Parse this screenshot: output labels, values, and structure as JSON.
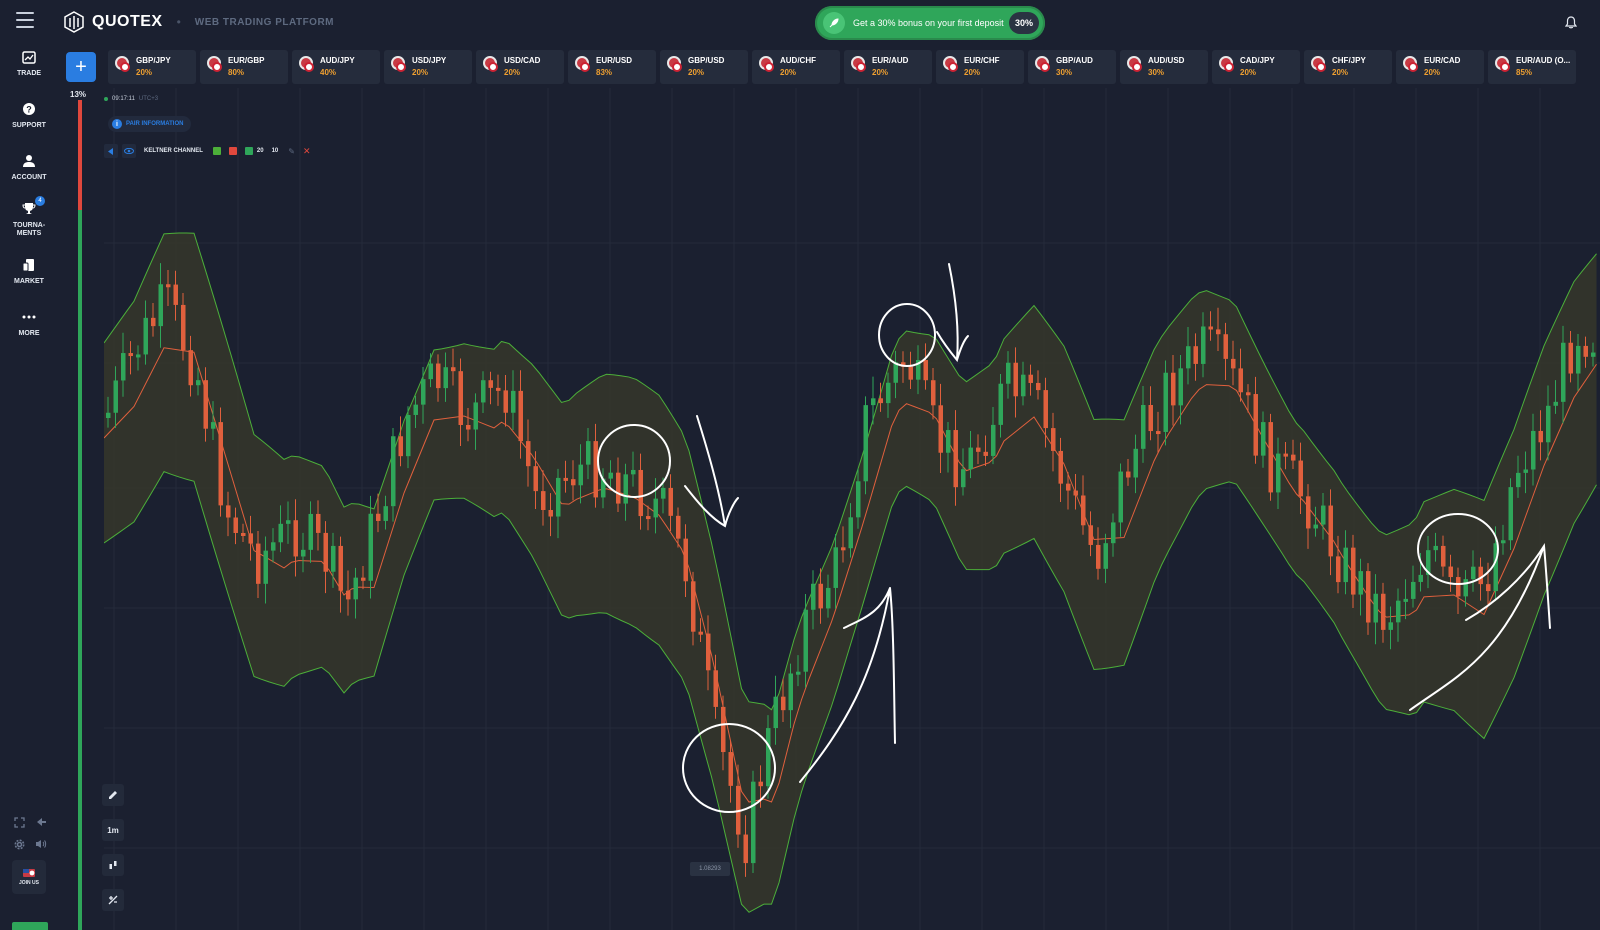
{
  "header": {
    "brand": "QUOTEX",
    "subtitle": "WEB TRADING PLATFORM",
    "bonus_text": "Get a 30% bonus on your first deposit",
    "bonus_pct": "30%"
  },
  "sidebar": {
    "items": [
      {
        "label": "TRADE",
        "icon": "trade-icon"
      },
      {
        "label": "SUPPORT",
        "icon": "support-icon"
      },
      {
        "label": "ACCOUNT",
        "icon": "account-icon"
      },
      {
        "label": "TOURNA-MENTS",
        "icon": "trophy-icon",
        "badge": "4"
      },
      {
        "label": "MARKET",
        "icon": "market-icon"
      },
      {
        "label": "MORE",
        "icon": "more-icon"
      }
    ],
    "join_label": "JOIN US"
  },
  "sentiment": {
    "pct_label": "13%",
    "up_fraction": 0.13
  },
  "assets": [
    {
      "name": "GBP/JPY",
      "payout": "20%"
    },
    {
      "name": "EUR/GBP",
      "payout": "80%"
    },
    {
      "name": "AUD/JPY",
      "payout": "40%"
    },
    {
      "name": "USD/JPY",
      "payout": "20%"
    },
    {
      "name": "USD/CAD",
      "payout": "20%"
    },
    {
      "name": "EUR/USD",
      "payout": "83%"
    },
    {
      "name": "GBP/USD",
      "payout": "20%"
    },
    {
      "name": "AUD/CHF",
      "payout": "20%"
    },
    {
      "name": "EUR/AUD",
      "payout": "20%"
    },
    {
      "name": "EUR/CHF",
      "payout": "20%"
    },
    {
      "name": "GBP/AUD",
      "payout": "30%"
    },
    {
      "name": "AUD/USD",
      "payout": "30%"
    },
    {
      "name": "CAD/JPY",
      "payout": "20%"
    },
    {
      "name": "CHF/JPY",
      "payout": "20%"
    },
    {
      "name": "EUR/CAD",
      "payout": "20%"
    },
    {
      "name": "EUR/AUD (O...",
      "payout": "85%"
    }
  ],
  "chart": {
    "time": "09:17:11",
    "timezone": "UTC+3",
    "pair_info_label": "PAIR INFORMATION",
    "indicator_name": "KELTNER CHANNEL",
    "indicator_period": "20",
    "indicator_multiplier": "10",
    "timeframe": "1m",
    "price_label": "1.08293",
    "colors": {
      "up": "#2fa65a",
      "down": "#e0603d",
      "band": "#4caf39",
      "mid": "#e0603d",
      "fill": "#3a3a2a"
    }
  }
}
